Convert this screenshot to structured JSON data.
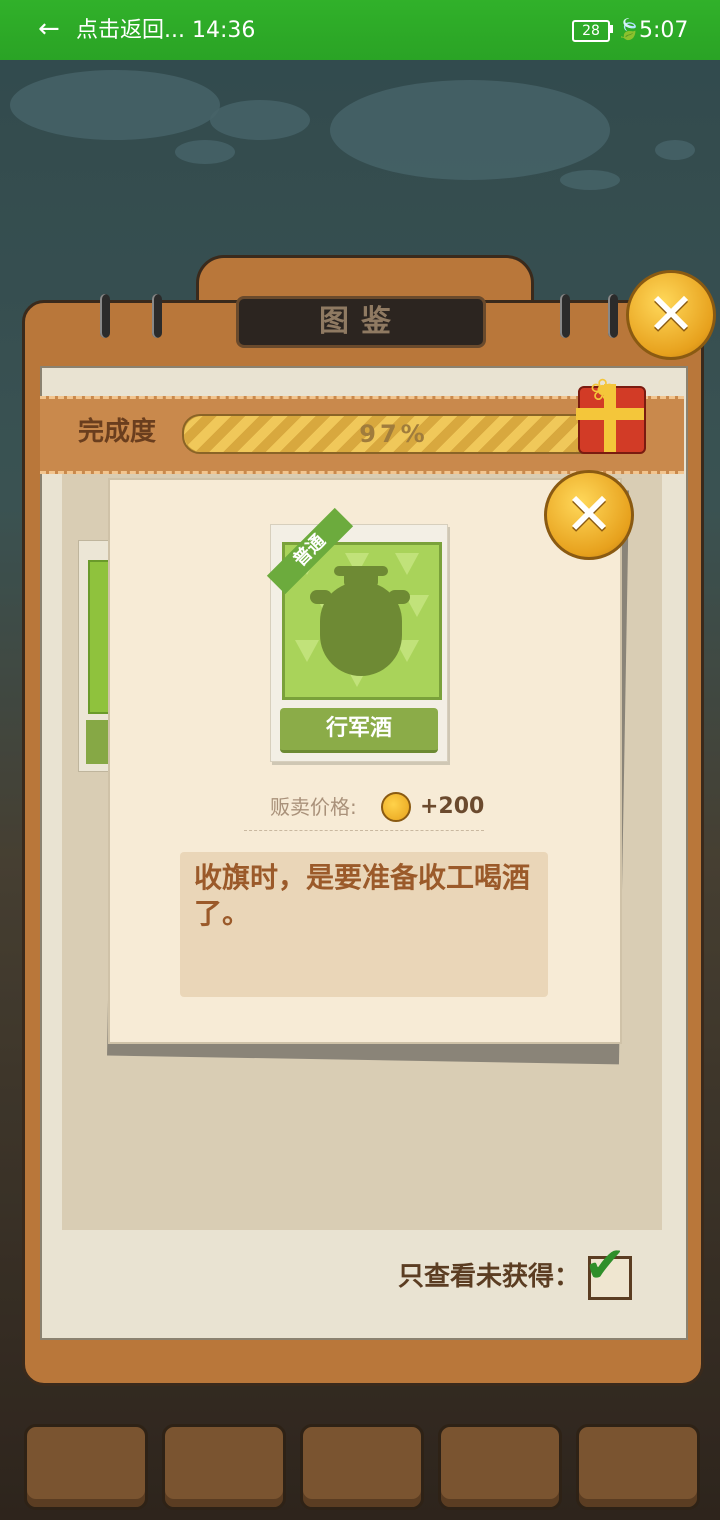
{
  "status_bar": {
    "back_glyph": "←",
    "title": "点击返回... 14:36",
    "battery": "28",
    "leaf_icon": "🍃",
    "time": "5:07"
  },
  "book": {
    "title": "图鉴",
    "completion_label": "完成度",
    "completion_percent": 97,
    "completion_text": "97%",
    "filter_label": "只查看未获得：",
    "filter_checked": true
  },
  "popup": {
    "rarity": "普通",
    "item_name": "行军酒",
    "price_label": "贩卖价格:",
    "price_value": "+200",
    "description": "收旗时，是要准备收工喝酒了。"
  },
  "icons": {
    "close": "✕",
    "check": "✔",
    "gift": "gift-icon",
    "coin": "coin-icon",
    "jar": "wine-jar-icon"
  },
  "colors": {
    "status_bar": "#2aa325",
    "panel_wood": "#b9773a",
    "item_green": "#a9d35a",
    "rarity_green": "#6cab3d",
    "desc_text": "#9b5a2a"
  }
}
